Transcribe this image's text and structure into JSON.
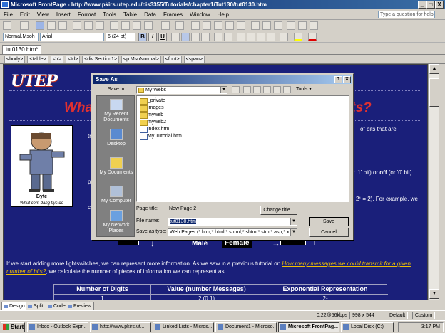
{
  "window": {
    "title": "Microsoft FrontPage - http://www.pkirs.utep.edu/cis3355/Tutorials/chapter1/Tut130/tut0130.htm",
    "min": "_",
    "max": "□",
    "close": "X"
  },
  "menu": {
    "items": [
      "File",
      "Edit",
      "View",
      "Insert",
      "Format",
      "Tools",
      "Table",
      "Data",
      "Frames",
      "Window",
      "Help"
    ],
    "question_placeholder": "Type a question for help"
  },
  "formatting": {
    "style": "Normal.Msoh",
    "font": "Arial",
    "size": "6 (24 pt)",
    "bold": "B",
    "italic": "I",
    "underline": "U"
  },
  "document": {
    "tab": "tut0130.htm*",
    "tags": [
      "<body>",
      "<table>",
      "<tr>",
      "<td>",
      "<div.Section1>",
      "<p.MsoNormal>",
      "<font>",
      "<span>"
    ]
  },
  "page": {
    "logo": "UTEP",
    "title_left": "Wha",
    "title_right": "its?",
    "frag_tra": "tra",
    "frag_ofbits": "of bits that are",
    "frag_bit": "r '1' bit) or",
    "frag_off": "off",
    "frag_bit2": "(or '0' bit)",
    "frag_pe": "pe",
    "frag_example": "2¹ = 2).  For example, we",
    "frag_co": "co",
    "cartoon_caption1": "Byte",
    "cartoon_caption2": "Whut cem dang flys do",
    "male": "Male",
    "female": "Female",
    "para_start": "If we start adding more lightswitches, we can represent more information. As we saw in a previous tutorial on",
    "para_link": "How many messages we could transmit for a given number of bits?",
    "para_end": ", we calculate the number of pieces of information we can represent as:",
    "table": {
      "headers": [
        "Number of Digits",
        "Value (number Messages)",
        "Exponential Representation"
      ],
      "row1": [
        "1",
        "2 (0    1)",
        "2¹"
      ]
    }
  },
  "dialog": {
    "title": "Save As",
    "help": "?",
    "close": "X",
    "save_in_label": "Save in:",
    "save_in_value": "My Webs",
    "tools_label": "Tools",
    "places": [
      "My Recent Documents",
      "Desktop",
      "My Documents",
      "My Computer",
      "My Network Places"
    ],
    "files": [
      {
        "name": "_private",
        "kind": "folder"
      },
      {
        "name": "images",
        "kind": "folder"
      },
      {
        "name": "myweb",
        "kind": "folder"
      },
      {
        "name": "myweb2",
        "kind": "folder"
      },
      {
        "name": "index.htm",
        "kind": "file"
      },
      {
        "name": "My Tutorial.htm",
        "kind": "file"
      }
    ],
    "page_title_label": "Page title:",
    "page_title_value": "New Page 2",
    "change_title_button": "Change title...",
    "file_name_label": "File name:",
    "file_name_value": "tut0130.htm",
    "save_as_type_label": "Save as type:",
    "save_as_type_value": "Web Pages (*.htm;*.html;*.shtml;*.shtm;*.stm;*.asp;*.x",
    "save_button": "Save",
    "cancel_button": "Cancel"
  },
  "viewtabs": [
    "Design",
    "Split",
    "Code",
    "Preview"
  ],
  "status": {
    "speed": "0:22@56kbps",
    "dimensions": "998 x 544",
    "mode": "Default",
    "custom": "Custom"
  },
  "taskbar": {
    "start": "Start",
    "items": [
      "Inbox - Outlook Expr...",
      "http://www.pkirs.ut...",
      "Linked Lists - Micros...",
      "Document1 - Microso...",
      "Microsoft FrontPag...",
      "Local Disk (C:)"
    ],
    "clock": "3:17 PM"
  }
}
